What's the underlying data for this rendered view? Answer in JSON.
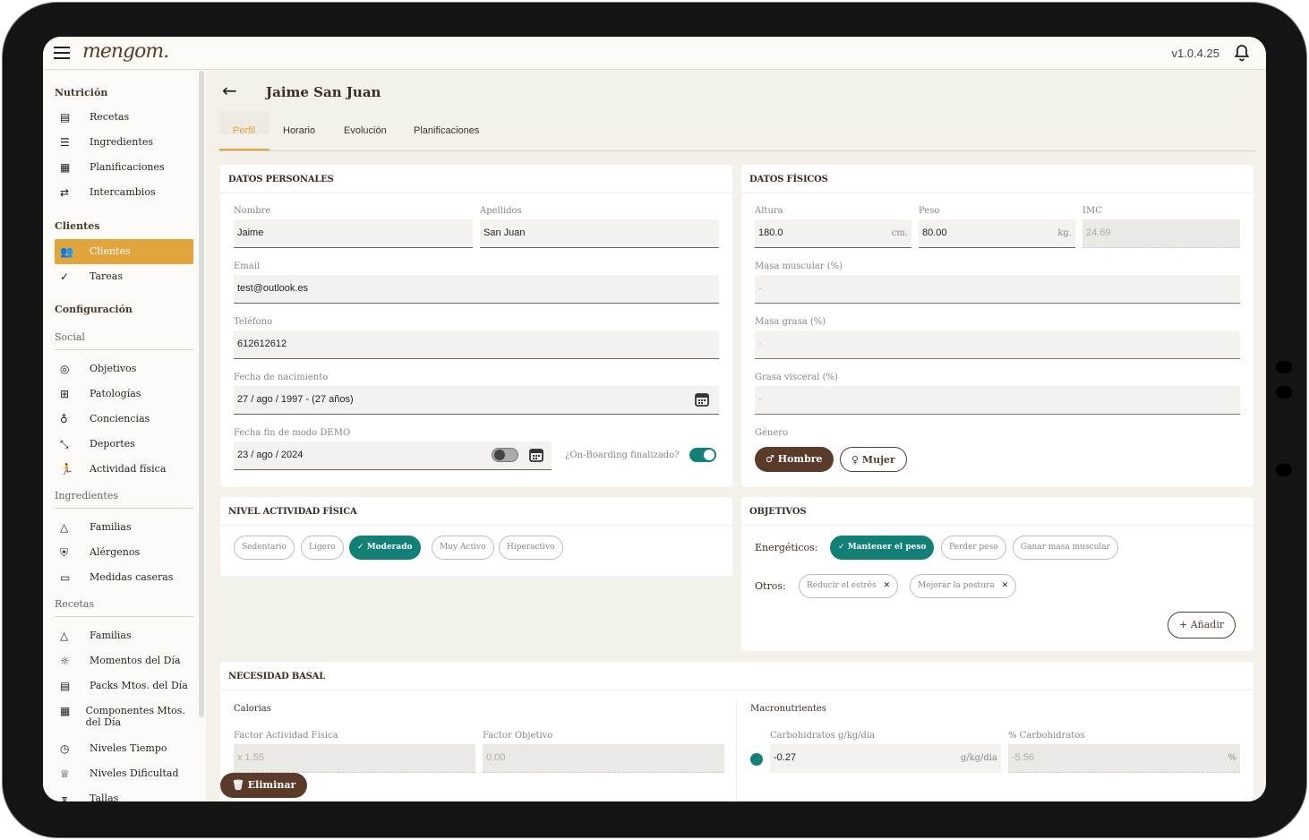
{
  "app": {
    "logo": "mengom.",
    "version": "v1.0.4.25"
  },
  "sidebar": {
    "nutricion": {
      "title": "Nutrición",
      "items": [
        {
          "label": "Recetas",
          "icon": "book-icon"
        },
        {
          "label": "Ingredientes",
          "icon": "list-icon"
        },
        {
          "label": "Planificaciones",
          "icon": "calendar-icon"
        },
        {
          "label": "Intercambios",
          "icon": "swap-icon"
        }
      ]
    },
    "clientes": {
      "title": "Clientes",
      "items": [
        {
          "label": "Clientes",
          "icon": "group-icon"
        },
        {
          "label": "Tareas",
          "icon": "check-circle-icon"
        }
      ]
    },
    "configuracion": {
      "title": "Configuración",
      "social": {
        "title": "Social",
        "items": [
          {
            "label": "Objetivos",
            "icon": "target-icon"
          },
          {
            "label": "Patologías",
            "icon": "medical-icon"
          },
          {
            "label": "Conciencias",
            "icon": "bulb-icon"
          },
          {
            "label": "Deportes",
            "icon": "sport-icon"
          },
          {
            "label": "Actividad física",
            "icon": "run-icon"
          }
        ]
      },
      "ingredientes": {
        "title": "Ingredientes",
        "items": [
          {
            "label": "Familias",
            "icon": "shapes-icon"
          },
          {
            "label": "Alérgenos",
            "icon": "shield-icon"
          },
          {
            "label": "Medidas caseras",
            "icon": "ruler-icon"
          }
        ]
      },
      "recetas": {
        "title": "Recetas",
        "items": [
          {
            "label": "Familias",
            "icon": "shapes-icon"
          },
          {
            "label": "Momentos del Día",
            "icon": "sun-icon"
          },
          {
            "label": "Packs Mtos. del Día",
            "icon": "pack-icon"
          },
          {
            "label": "Componentes Mtos. del Día",
            "icon": "calendar-list-icon"
          },
          {
            "label": "Niveles Tiempo",
            "icon": "clock-icon"
          },
          {
            "label": "Niveles Dificultad",
            "icon": "trophy-icon"
          },
          {
            "label": "Tallas",
            "icon": "hanger-icon"
          }
        ]
      }
    }
  },
  "header": {
    "title": "Jaime San Juan"
  },
  "tabs": [
    "Perfil",
    "Horario",
    "Evolución",
    "Planificaciones"
  ],
  "personal": {
    "title": "DATOS PERSONALES",
    "nombre_label": "Nombre",
    "nombre": "Jaime",
    "apellidos_label": "Apellidos",
    "apellidos": "San Juan",
    "email_label": "Email",
    "email": "test@outlook.es",
    "telefono_label": "Teléfono",
    "telefono": "612612612",
    "nacimiento_label": "Fecha de nacimiento",
    "nacimiento": "27 / ago / 1997 - (27 años)",
    "demo_label": "Fecha fin de modo DEMO",
    "demo": "23 / ago / 2024",
    "onboarding_label": "¿On-Boarding finalizado?",
    "onboarding": true,
    "demo_toggle": false
  },
  "fisicos": {
    "title": "DATOS FÍSICOS",
    "altura_label": "Altura",
    "altura": "180.0",
    "altura_unit": "cm.",
    "peso_label": "Peso",
    "peso": "80.00",
    "peso_unit": "kg.",
    "imc_label": "IMC",
    "imc": "24.69",
    "masa_muscular_label": "Masa muscular (%)",
    "masa_muscular": "-",
    "masa_grasa_label": "Masa grasa (%)",
    "masa_grasa": "-",
    "grasa_visceral_label": "Grasa visceral (%)",
    "grasa_visceral": "-",
    "genero_label": "Género",
    "hombre": "Hombre",
    "mujer": "Mujer",
    "genero_selected": "Hombre"
  },
  "actividad": {
    "title": "NIVEL ACTIVIDAD FÍSICA",
    "options": [
      "Sedentario",
      "Ligero",
      "Moderado",
      "Muy Activo",
      "Hiperactivo"
    ],
    "selected": "Moderado"
  },
  "objetivos": {
    "title": "OBJETIVOS",
    "energeticos_label": "Energéticos:",
    "energeticos": [
      "Mantener el peso",
      "Perder peso",
      "Ganar masa muscular"
    ],
    "selected": "Mantener el peso",
    "otros_label": "Otros:",
    "otros": [
      "Reducir el estrés",
      "Mejorar la postura"
    ],
    "add": "Añadir"
  },
  "basal": {
    "title": "NECESIDAD BASAL",
    "calorias": "Calorias",
    "factor_actividad_label": "Factor Actividad Física",
    "factor_actividad": "x 1.55",
    "factor_objetivo_label": "Factor Objetivo",
    "factor_objetivo": "0.00",
    "macros": "Macronutrientes",
    "carb_label": "Carbohidratos g/kg/dia",
    "carb": "-0.27",
    "carb_unit": "g/kg/dia",
    "pct_carb_label": "% Carbohidratos",
    "pct_carb": "-5.56",
    "pct_unit": "%"
  },
  "delete": "Eliminar",
  "colors": {
    "accent": "#e2a43d",
    "teal": "#128077",
    "brown": "#5a3b2a"
  }
}
